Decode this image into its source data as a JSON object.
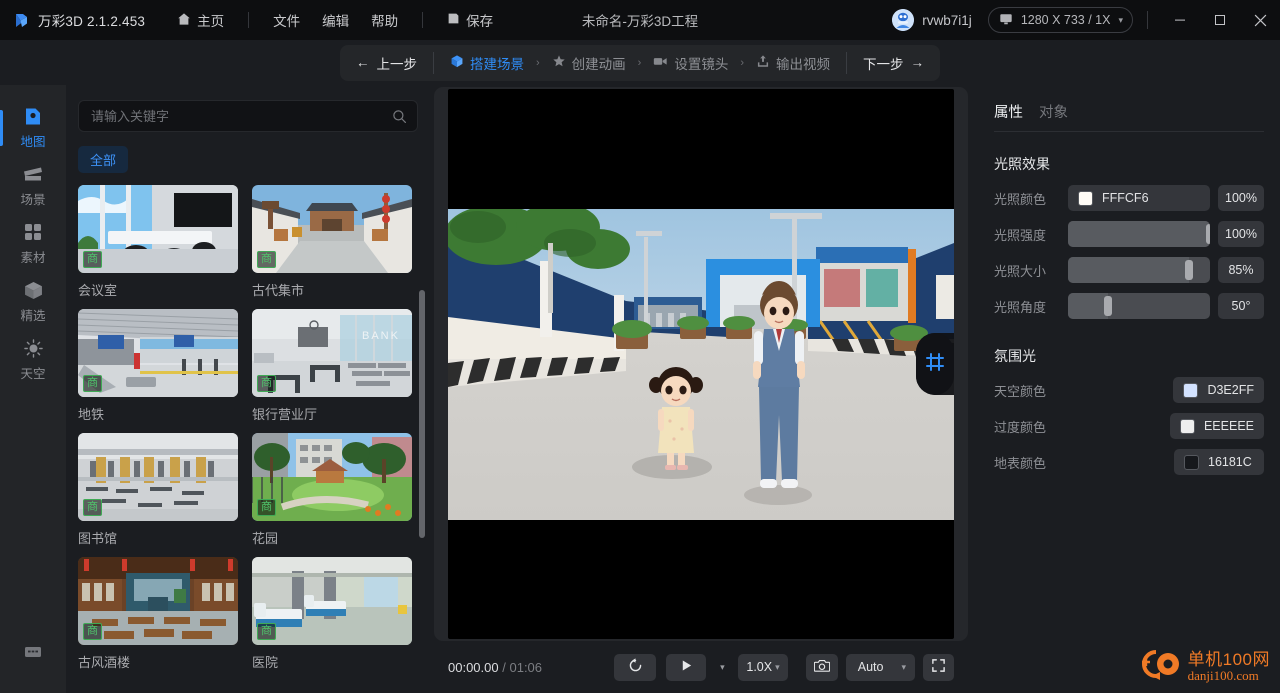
{
  "titlebar": {
    "brand": "万彩3D 2.1.2.453",
    "home": "主页",
    "menus": [
      "文件",
      "编辑",
      "帮助"
    ],
    "save": "保存",
    "doc_title": "未命名-万彩3D工程",
    "username": "rvwb7i1j",
    "resolution": "1280 X 733 / 1X",
    "icons": {
      "home": "home-icon",
      "save": "save-icon",
      "monitor": "monitor-icon",
      "chevron": "chevron-down-icon",
      "minimize": "minimize-icon",
      "maximize": "maximize-icon",
      "close": "close-icon"
    }
  },
  "stepbar": {
    "prev": "上一步",
    "next": "下一步",
    "steps": [
      {
        "label": "搭建场景",
        "icon": "cube-icon",
        "active": true
      },
      {
        "label": "创建动画",
        "icon": "star-icon",
        "active": false
      },
      {
        "label": "设置镜头",
        "icon": "camera-icon",
        "active": false
      },
      {
        "label": "输出视频",
        "icon": "export-icon",
        "active": false
      }
    ]
  },
  "sidebar": {
    "items": [
      {
        "label": "地图",
        "icon": "map-icon",
        "active": true
      },
      {
        "label": "场景",
        "icon": "scene-icon",
        "active": false
      },
      {
        "label": "素材",
        "icon": "assets-icon",
        "active": false
      },
      {
        "label": "精选",
        "icon": "featured-cube-icon",
        "active": false
      },
      {
        "label": "天空",
        "icon": "sun-icon",
        "active": false
      }
    ],
    "bottom_icon": "keyboard-icon"
  },
  "gallery": {
    "search_placeholder": "请输入关键字",
    "search_value": "",
    "filters": [
      {
        "label": "全部",
        "active": true
      }
    ],
    "badge_text": "商",
    "items": [
      {
        "label": "会议室",
        "badge": "商"
      },
      {
        "label": "古代集市",
        "badge": "商"
      },
      {
        "label": "地铁",
        "badge": "商"
      },
      {
        "label": "银行营业厅",
        "badge": "商"
      },
      {
        "label": "图书馆",
        "badge": "商"
      },
      {
        "label": "花园",
        "badge": "商"
      },
      {
        "label": "古风酒楼",
        "badge": "商"
      },
      {
        "label": "医院",
        "badge": "商"
      }
    ]
  },
  "viewport": {
    "gizmo_icon": "frame-crop-icon"
  },
  "playbar": {
    "current_time": "00:00.00",
    "separator": "/",
    "total_time": "01:06",
    "restart_icon": "restart-icon",
    "play_icon": "play-icon",
    "speed": "1.0X",
    "snapshot_icon": "camera-snapshot-icon",
    "quality": "Auto",
    "fullscreen_icon": "fullscreen-icon"
  },
  "props": {
    "tabs": [
      {
        "label": "属性",
        "active": true
      },
      {
        "label": "对象",
        "active": false
      }
    ],
    "lighting": {
      "title": "光照效果",
      "rows": [
        {
          "label": "光照颜色",
          "type": "color",
          "color": "#FFFCF6",
          "hex": "FFFCF6",
          "value": "100%"
        },
        {
          "label": "光照强度",
          "type": "slider",
          "percent": 100,
          "value": "100%"
        },
        {
          "label": "光照大小",
          "type": "slider",
          "percent": 85,
          "value": "85%"
        },
        {
          "label": "光照角度",
          "type": "slider",
          "percent": 28,
          "value": "50°"
        }
      ]
    },
    "ambient": {
      "title": "氛围光",
      "rows": [
        {
          "label": "天空颜色",
          "color": "#D3E2FF",
          "hex": "D3E2FF"
        },
        {
          "label": "过度颜色",
          "color": "#EEEEEE",
          "hex": "EEEEEE"
        },
        {
          "label": "地表颜色",
          "color": "#16181C",
          "hex": "16181C"
        }
      ]
    }
  },
  "watermark": {
    "cn": "单机100网",
    "en": "danji100.com",
    "color": "#f07a26"
  },
  "theme": {
    "accent": "#2f8cf5",
    "badge_green": "#4fc46b",
    "panel": "#1b1d21",
    "titlebar": "#0d0e10"
  }
}
